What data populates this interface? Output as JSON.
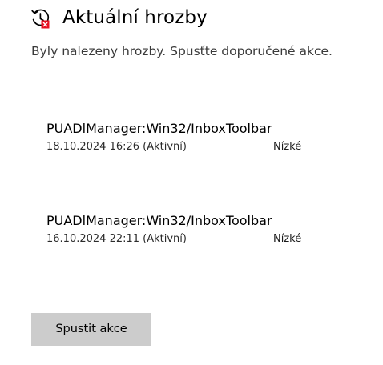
{
  "header": {
    "icon": "clock-history-warning-icon",
    "title": "Aktuální hrozby"
  },
  "subtitle": "Byly nalezeny hrozby. Spusťte doporučené akce.",
  "threats": [
    {
      "name": "PUADlManager:Win32/InboxToolbar",
      "date": "18.10.2024 16:26 (Aktivní)",
      "severity": "Nízké"
    },
    {
      "name": "PUADlManager:Win32/InboxToolbar",
      "date": "16.10.2024 22:11 (Aktivní)",
      "severity": "Nízké"
    }
  ],
  "actions": {
    "start_label": "Spustit akce"
  },
  "colors": {
    "background": "#ffffff",
    "text": "#000000",
    "button_bg": "#cccccc",
    "alert_red": "#e81123"
  }
}
